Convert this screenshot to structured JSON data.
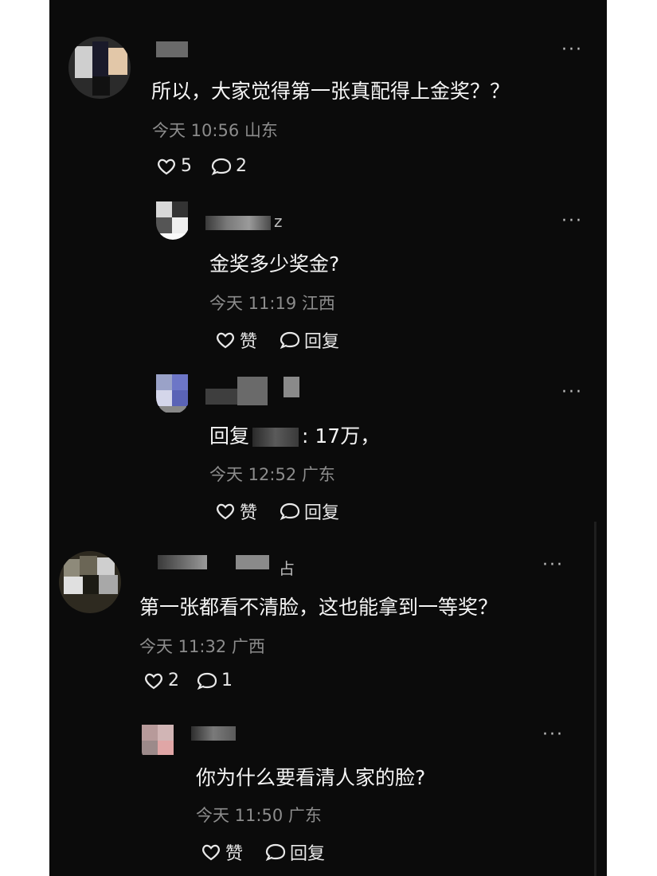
{
  "comments": [
    {
      "id": "c1",
      "text": "所以，大家觉得第一张真配得上金奖？？",
      "meta": "今天 10:56 山东",
      "likes": "5",
      "replies_count": "2"
    },
    {
      "id": "r1",
      "name_tail": "z",
      "text": "金奖多少奖金?",
      "meta": "今天 11:19 江西",
      "like_label": "赞",
      "reply_label": "回复"
    },
    {
      "id": "r2",
      "reply_prefix": "回复",
      "text_after": ": 17万，",
      "meta": "今天 12:52 广东",
      "like_label": "赞",
      "reply_label": "回复"
    },
    {
      "id": "c2",
      "name_tail": "占",
      "text": "第一张都看不清脸，这也能拿到一等奖？",
      "meta": "今天 11:32 广西",
      "likes": "2",
      "replies_count": "1"
    },
    {
      "id": "r3",
      "text": "你为什么要看清人家的脸?",
      "meta": "今天 11:50 广东",
      "like_label": "赞",
      "reply_label": "回复"
    }
  ],
  "more_glyph": "···",
  "colors": {
    "background": "#0b0b0b",
    "text": "#f4f4f4",
    "meta": "#8c8c8c"
  }
}
